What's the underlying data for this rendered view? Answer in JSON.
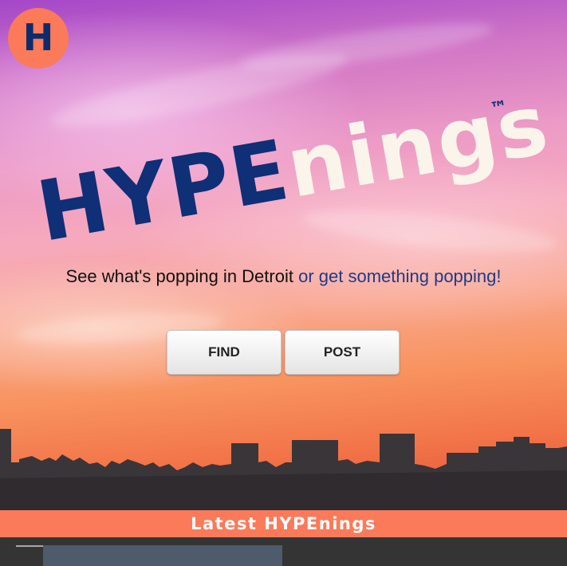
{
  "app": {
    "logo_letter": "H"
  },
  "hero": {
    "wordmark_primary": "HYPE",
    "wordmark_secondary": "nings",
    "trademark": "™",
    "tagline_plain": "See what's popping in Detroit ",
    "tagline_link": "or get something popping!"
  },
  "actions": {
    "find_label": "FIND",
    "post_label": "POST"
  },
  "latest": {
    "title": "Latest HYPEnings"
  },
  "colors": {
    "accent": "#fb7a5a",
    "brand_navy": "#0f2f76",
    "link": "#1f3a88",
    "dark_band": "#343434",
    "card": "#4e5b6b"
  }
}
